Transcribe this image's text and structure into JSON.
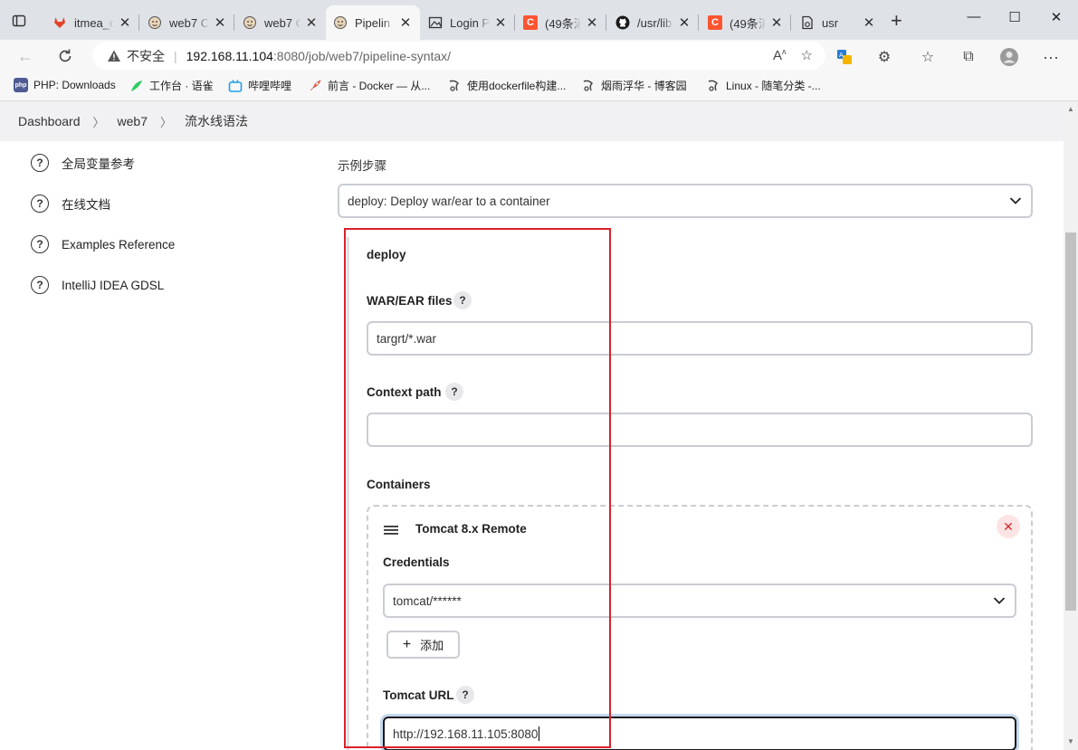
{
  "browser": {
    "tabs": [
      {
        "title": "itmea_c",
        "favicon": "gitlab-icon"
      },
      {
        "title": "web7 C",
        "favicon": "jenkins-icon"
      },
      {
        "title": "web7 C",
        "favicon": "jenkins-icon"
      },
      {
        "title": "Pipelin",
        "favicon": "jenkins-icon",
        "active": true
      },
      {
        "title": "Login P",
        "favicon": "image-icon"
      },
      {
        "title": "(49条消",
        "favicon": "csdn-icon"
      },
      {
        "title": "/usr/lib",
        "favicon": "github-icon"
      },
      {
        "title": "(49条消",
        "favicon": "csdn-icon"
      },
      {
        "title": "usr",
        "favicon": "page-icon"
      }
    ],
    "address": {
      "security": "不安全",
      "host": "192.168.11.104",
      "path": ":8080/job/web7/pipeline-syntax/"
    },
    "bookmarks": [
      {
        "label": "PHP: Downloads"
      },
      {
        "label": "工作台 · 语雀"
      },
      {
        "label": "哔哩哔哩"
      },
      {
        "label": "前言 - Docker — 从..."
      },
      {
        "label": "使用dockerfile构建..."
      },
      {
        "label": "烟雨浮华 - 博客园"
      },
      {
        "label": "Linux - 随笔分类 -..."
      }
    ]
  },
  "breadcrumb": {
    "items": [
      "Dashboard",
      "web7",
      "流水线语法"
    ]
  },
  "sidebar": {
    "items": [
      {
        "label": "全局变量参考"
      },
      {
        "label": "在线文档"
      },
      {
        "label": "Examples Reference"
      },
      {
        "label": "IntelliJ IDEA GDSL"
      }
    ]
  },
  "form": {
    "sample_step_label": "示例步骤",
    "sample_step_value": "deploy: Deploy war/ear to a container",
    "section_title": "deploy",
    "war_label": "WAR/EAR files",
    "war_value": "targrt/*.war",
    "context_label": "Context path",
    "context_value": "",
    "containers_label": "Containers",
    "container": {
      "title": "Tomcat 8.x Remote",
      "credentials_label": "Credentials",
      "credentials_value": "tomcat/******",
      "add_button": "添加",
      "url_label": "Tomcat URL",
      "url_value": "http://192.168.11.105:8080"
    },
    "help_glyph": "?"
  },
  "colors": {
    "highlight_box": "#d9212b",
    "delete_accent": "#d12c2c"
  }
}
